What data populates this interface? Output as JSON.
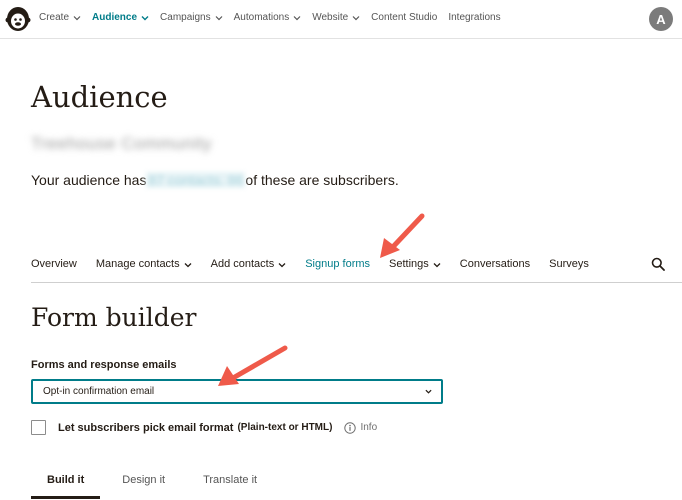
{
  "topnav": {
    "items": [
      {
        "label": "Create",
        "has_menu": true
      },
      {
        "label": "Audience",
        "has_menu": true,
        "active": true
      },
      {
        "label": "Campaigns",
        "has_menu": true
      },
      {
        "label": "Automations",
        "has_menu": true
      },
      {
        "label": "Website",
        "has_menu": true
      },
      {
        "label": "Content Studio",
        "has_menu": false
      },
      {
        "label": "Integrations",
        "has_menu": false
      }
    ],
    "avatar_initial": "A",
    "accent_color": "#007c89"
  },
  "header": {
    "title": "Audience",
    "audience_name": "Treehouse Community",
    "summary_prefix": "Your audience has",
    "summary_count_blurred": "87 contacts. 86",
    "summary_suffix": "of these are subscribers."
  },
  "subnav": {
    "items": [
      {
        "label": "Overview"
      },
      {
        "label": "Manage contacts",
        "has_menu": true
      },
      {
        "label": "Add contacts",
        "has_menu": true
      },
      {
        "label": "Signup forms",
        "active": true
      },
      {
        "label": "Settings",
        "has_menu": true
      },
      {
        "label": "Conversations"
      },
      {
        "label": "Surveys"
      }
    ]
  },
  "form_builder": {
    "title": "Form builder",
    "select_label": "Forms and response emails",
    "select_value": "Opt-in confirmation email",
    "checkbox_label": "Let subscribers pick email format",
    "checkbox_sub": "(Plain-text or HTML)",
    "checkbox_checked": false,
    "info_label": "Info",
    "tabs": [
      {
        "label": "Build it",
        "active": true
      },
      {
        "label": "Design it"
      },
      {
        "label": "Translate it"
      }
    ]
  },
  "annotation": {
    "arrow_color": "#ef5a4a"
  }
}
